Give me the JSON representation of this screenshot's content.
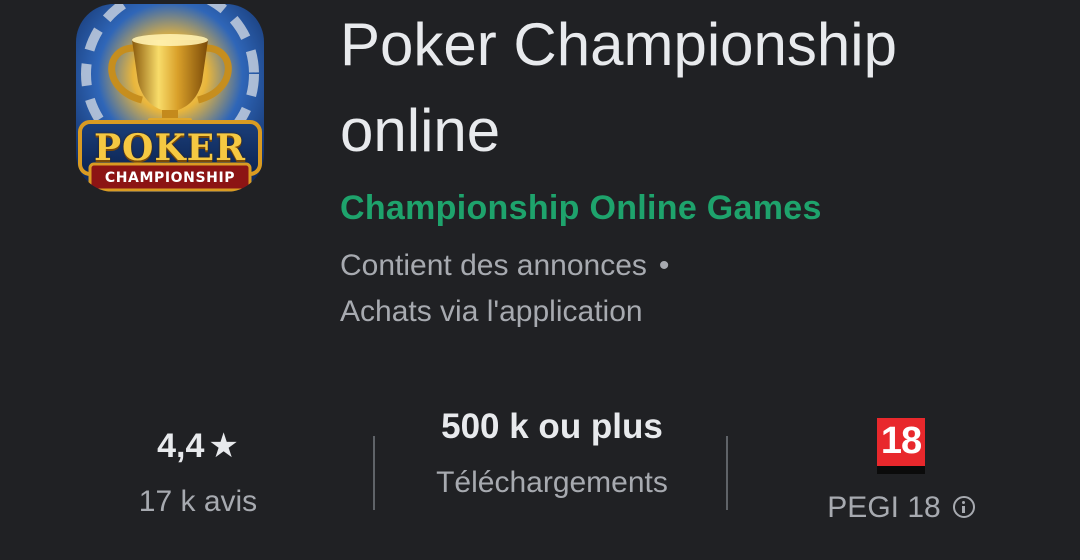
{
  "app": {
    "title": "Poker Championship online",
    "developer": "Championship Online Games",
    "icon_text_main": "POKER",
    "icon_text_sub": "CHAMPIONSHIP"
  },
  "meta": {
    "ads_notice": "Contient des annonces",
    "separator": "•",
    "iap_notice": "Achats via l'application"
  },
  "stats": {
    "rating": {
      "value": "4,4",
      "icon": "star-icon",
      "reviews": "17 k avis"
    },
    "downloads": {
      "value": "500 k ou plus",
      "label": "Téléchargements"
    },
    "content_rating": {
      "badge": "18",
      "label": "PEGI 18",
      "icon": "info-icon"
    }
  },
  "colors": {
    "background": "#202124",
    "developer_accent": "#1ea36c",
    "pegi_red": "#e8282c"
  }
}
